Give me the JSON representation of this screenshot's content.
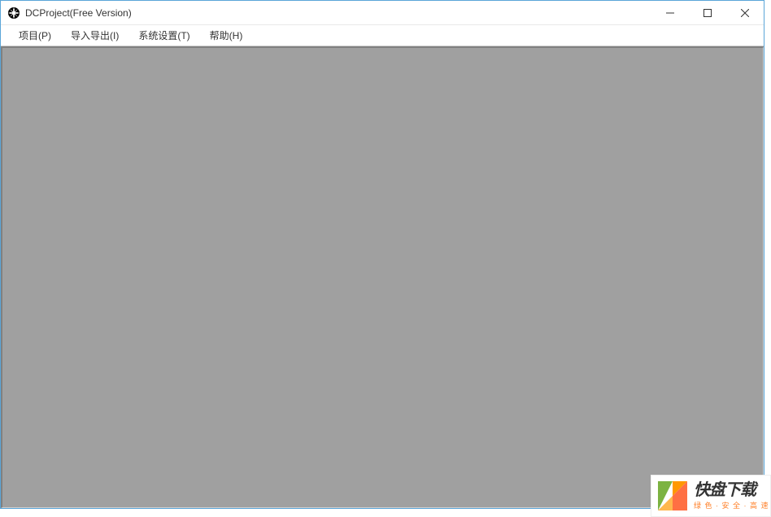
{
  "window": {
    "title": "DCProject(Free Version)"
  },
  "menu": {
    "items": [
      "项目(P)",
      "导入导出(I)",
      "系统设置(T)",
      "帮助(H)"
    ]
  },
  "watermark": {
    "main": "快盘下载",
    "sub": "绿 色 · 安 全 · 高 速"
  }
}
